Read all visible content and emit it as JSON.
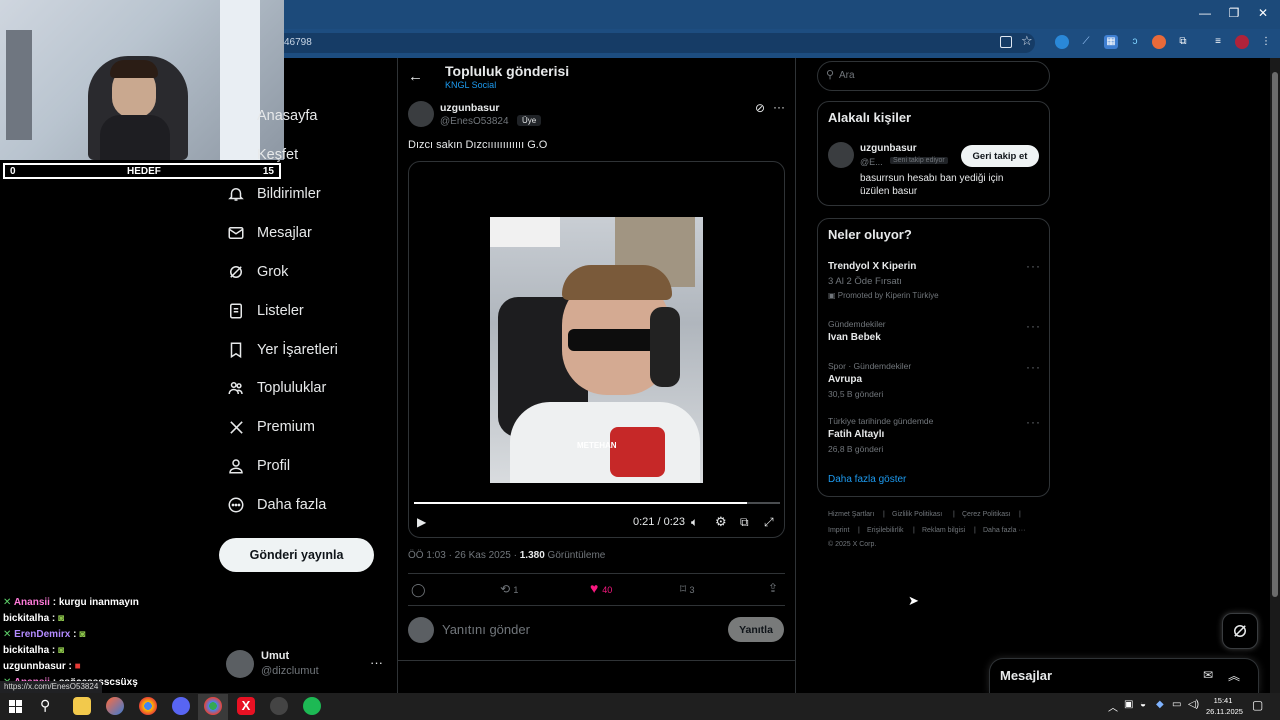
{
  "browser": {
    "url_fragment": "46798",
    "status_url": "https://x.com/EnesO53824"
  },
  "stream": {
    "goal_left": "0",
    "goal_label": "HEDEF",
    "goal_right": "15",
    "chat": [
      {
        "user": "Anansii",
        "user_color": "#ff7ad9",
        "message": "kurgu inanmayın",
        "prefix": "✕"
      },
      {
        "user": "bickitalha",
        "user_color": "#ffffff",
        "message": "",
        "prefix": ""
      },
      {
        "user": "ErenDemirx",
        "user_color": "#b38bff",
        "message": "",
        "prefix": "✕"
      },
      {
        "user": "bickitalha",
        "user_color": "#ffffff",
        "message": "",
        "prefix": ""
      },
      {
        "user": "uzgunnbasur",
        "user_color": "#ffffff",
        "message": "",
        "prefix": ""
      },
      {
        "user": "Anansii",
        "user_color": "#ff7ad9",
        "message": "ssöcesssscsüxş",
        "prefix": "✕"
      }
    ]
  },
  "nav": {
    "home": "Anasayfa",
    "explore": "Keşfet",
    "notifications": "Bildirimler",
    "messages": "Mesajlar",
    "grok": "Grok",
    "lists": "Listeler",
    "bookmarks": "Yer İşaretleri",
    "communities": "Topluluklar",
    "premium": "Premium",
    "profile": "Profil",
    "more": "Daha fazla",
    "post_button": "Gönderi yayınla",
    "account_name": "Umut",
    "account_handle": "@dizclumut"
  },
  "post": {
    "header_title": "Topluluk gönderisi",
    "header_sub": "KNGL Social",
    "author_name": "uzgunbasur",
    "author_handle": "@EnesO53824",
    "member_badge": "Üye",
    "text": "Dızcı sakın Dızcıııııııııııı G.O",
    "video_caption": "METEHAN",
    "video_time": "0:21 / 0:23",
    "video_progress": 0.91,
    "meta_time": "ÖÖ 1:03 · 26 Kas 2025 ·",
    "views_count": "1.380",
    "views_label": "Görüntüleme",
    "retweets": "1",
    "likes": "40",
    "bookmarks": "3",
    "reply_placeholder": "Yanıtını gönder",
    "reply_button": "Yanıtla"
  },
  "sidebar": {
    "search_placeholder": "Ara",
    "relevant_title": "Alakalı kişiler",
    "person_name": "uzgunbasur",
    "person_handle": "@E...",
    "person_follows_you": "Seni takip ediyor",
    "follow_back": "Geri takip et",
    "person_bio": "basurrsun hesabı ban yediği için üzülen basur",
    "whats_happening": "Neler oluyor?",
    "trends": [
      {
        "context": "",
        "title": "Trendyol X Kiperin",
        "sub": "3 Al 2 Öde Fırsatı",
        "extra": "Promoted by Kiperin Türkiye"
      },
      {
        "context": "Gündemdekiler",
        "title": "Ivan Bebek",
        "sub": "",
        "extra": ""
      },
      {
        "context": "Spor · Gündemdekiler",
        "title": "Avrupa",
        "sub": "30,5 B gönderi",
        "extra": ""
      },
      {
        "context": "Türkiye tarihinde gündemde",
        "title": "Fatih Altaylı",
        "sub": "26,8 B gönderi",
        "extra": ""
      }
    ],
    "show_more": "Daha fazla göster",
    "footer": [
      "Hizmet Şartları",
      "Gizlilik Politikası",
      "Çerez Politikası",
      "Imprint",
      "Erişilebilirlik",
      "Reklam bilgisi",
      "Daha fazla ···",
      "© 2025 X Corp."
    ],
    "messages_drawer": "Mesajlar"
  },
  "taskbar": {
    "time": "15:41",
    "date": "26.11.2025"
  },
  "colors": {
    "accent": "#1d9bf0",
    "like": "#f91880",
    "border": "#2f3336",
    "muted": "#71767b"
  }
}
